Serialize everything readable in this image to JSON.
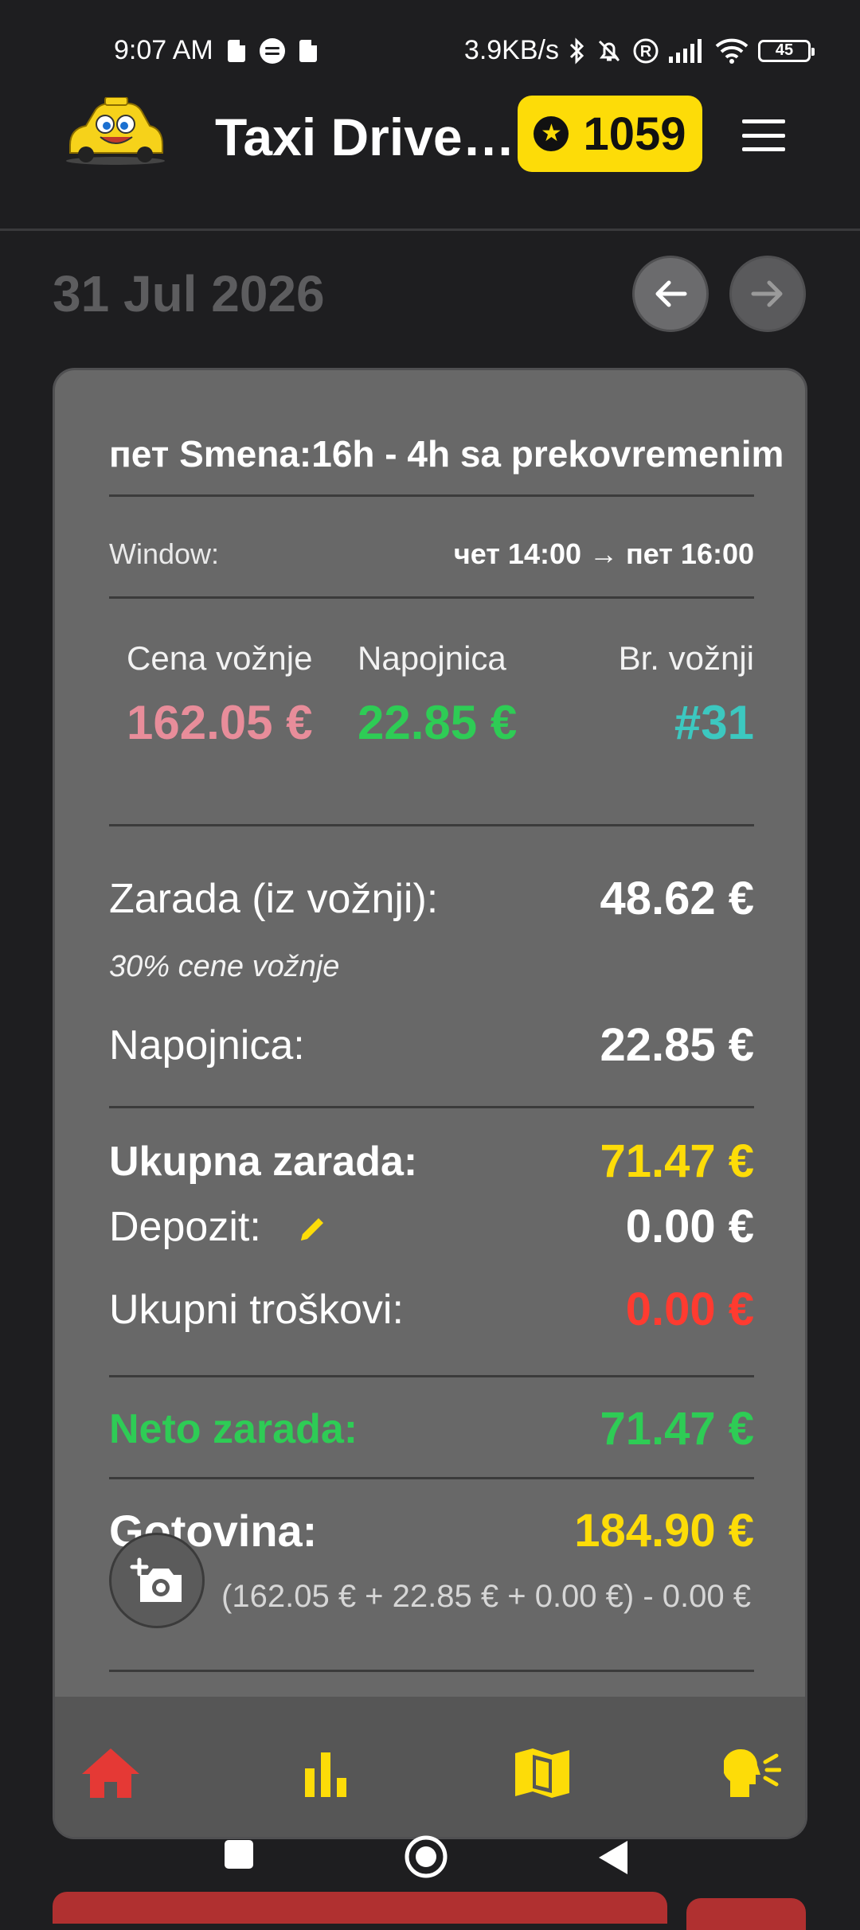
{
  "status_bar": {
    "time": "9:07 AM",
    "network_speed": "3.9KB/s",
    "battery": "45"
  },
  "app_bar": {
    "title": "Taxi Driver...",
    "coins": "1059"
  },
  "date_nav": {
    "date": "31 Jul 2026"
  },
  "shift": {
    "title": "пет Smena:16h - 4h sa prekovremenim",
    "window_label": "Window:",
    "window_value": "чет 14:00 → пет 16:00"
  },
  "stats": {
    "price_label": "Cena vožnje",
    "price_value": "162.05 €",
    "tip_label": "Napojnica",
    "tip_value": "22.85 €",
    "rides_label": "Br. vožnji",
    "rides_value": "#31"
  },
  "earnings": {
    "rides_label": "Zarada (iz vožnji):",
    "rides_value": "48.62 €",
    "rides_note": "30% cene vožnje",
    "tip_label": "Napojnica:",
    "tip_value": "22.85 €",
    "total_label": "Ukupna zarada:",
    "total_value": "71.47 €",
    "deposit_label": "Depozit:",
    "deposit_value": "0.00 €",
    "costs_label": "Ukupni troškovi:",
    "costs_value": "0.00 €",
    "net_label": "Neto zarada:",
    "net_value": "71.47 €",
    "cash_label": "Gotovina:",
    "cash_value": "184.90 €",
    "cash_formula": "(162.05 € + 22.85 € + 0.00 €) - 0.00 €"
  },
  "colors": {
    "accent_yellow": "#fddc08",
    "price_pink": "#e88d9a",
    "tip_green": "#2ecc55",
    "rides_teal": "#3cc8c0",
    "cost_red": "#ff3b30",
    "home_red": "#e53935"
  },
  "icons": {
    "logo": "taxi-logo",
    "coin": "star-coin-icon",
    "menu": "hamburger-menu-icon",
    "prev": "arrow-left-icon",
    "next": "arrow-right-icon",
    "edit": "pencil-icon",
    "camera": "add-photo-camera-icon",
    "nav_home": "home-icon",
    "nav_stats": "bar-chart-icon",
    "nav_map": "map-icon",
    "nav_voice": "voice-speak-icon"
  }
}
